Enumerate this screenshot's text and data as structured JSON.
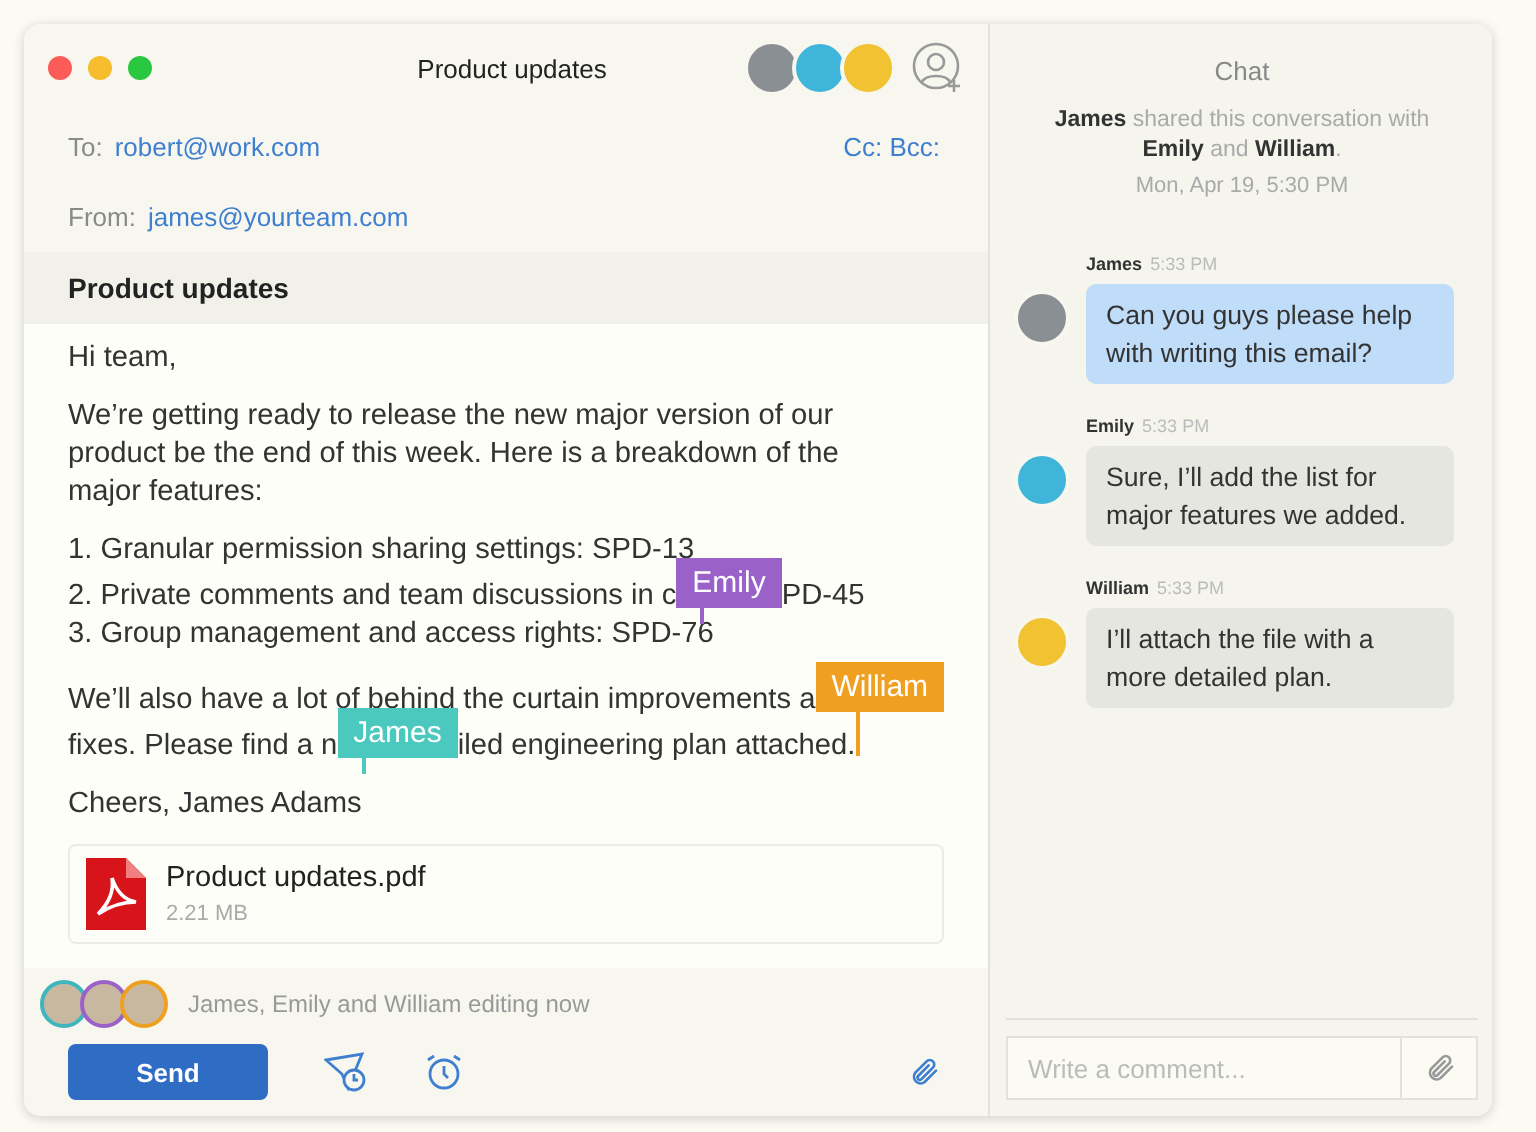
{
  "window": {
    "title": "Product updates"
  },
  "participants": [
    {
      "color": "#8a8f93"
    },
    {
      "color": "#3fb6d9"
    },
    {
      "color": "#f1c232"
    }
  ],
  "to": {
    "label": "To:",
    "value": "robert@work.com",
    "cc": "Cc:",
    "bcc": "Bcc:"
  },
  "from": {
    "label": "From:",
    "value": "james@yourteam.com"
  },
  "subject": "Product updates",
  "body": [
    {
      "lines": [
        [
          {
            "kind": "text",
            "text": "Hi team,"
          }
        ]
      ]
    },
    {
      "lines": [
        [
          {
            "kind": "text",
            "text": "We’re getting ready to release the new major version of our"
          }
        ],
        [
          {
            "kind": "text",
            "text": "product be the end of this week. Here is a breakdown of the"
          }
        ],
        [
          {
            "kind": "text",
            "text": "major features:"
          }
        ]
      ]
    },
    {
      "lines": [
        [
          {
            "kind": "text",
            "text": "1. Granular permission sharing settings: SPD-13"
          }
        ],
        [
          {
            "kind": "text",
            "text": "2. Private comments and team discussions in c"
          },
          {
            "kind": "cursor",
            "name": "Emily",
            "color": "#9a62c9"
          },
          {
            "kind": "text",
            "text": "PD-45"
          }
        ],
        [
          {
            "kind": "text",
            "text": "3. Group management and access rights: SPD-76"
          }
        ]
      ]
    },
    {
      "lines": [
        [
          {
            "kind": "text",
            "text": "We’ll also have a lot of behind the curtain improvements a"
          },
          {
            "kind": "cursor",
            "name": "William",
            "color": "#f0a020"
          }
        ],
        [
          {
            "kind": "text",
            "text": "fixes. Please find a n"
          },
          {
            "kind": "cursor",
            "name": "James",
            "color": "#4cc9bf"
          },
          {
            "kind": "text",
            "text": "iled engineering plan attached."
          }
        ]
      ]
    },
    {
      "lines": [
        [
          {
            "kind": "text",
            "text": "Cheers, James Adams"
          }
        ]
      ]
    }
  ],
  "attachment": {
    "name": "Product updates.pdf",
    "size": "2.21 MB"
  },
  "editors": {
    "avatars": [
      {
        "color": "#3fb6bd"
      },
      {
        "color": "#9a62c9"
      },
      {
        "color": "#f0a020"
      }
    ],
    "text": "James, Emily and William editing now"
  },
  "toolbar": {
    "send": "Send"
  },
  "chat": {
    "title": "Chat",
    "shared": "**James** shared this conversation with **Emily** and **William**.",
    "date": "Mon, Apr 19, 5:30 PM",
    "messages": [
      {
        "sender": "James",
        "time": "5:33 PM",
        "text": "Can you guys please help with writing this email?",
        "kind": "outgoing",
        "color": "#8a8f93"
      },
      {
        "sender": "Emily",
        "time": "5:33 PM",
        "text": "Sure, I’ll add the list for major features we added.",
        "kind": "incoming",
        "color": "#3fb6d9"
      },
      {
        "sender": "William",
        "time": "5:33 PM",
        "text": "I’ll attach the file with a more detailed plan.",
        "kind": "incoming",
        "color": "#f1c232"
      }
    ],
    "input": {
      "placeholder": "Write a comment..."
    }
  }
}
